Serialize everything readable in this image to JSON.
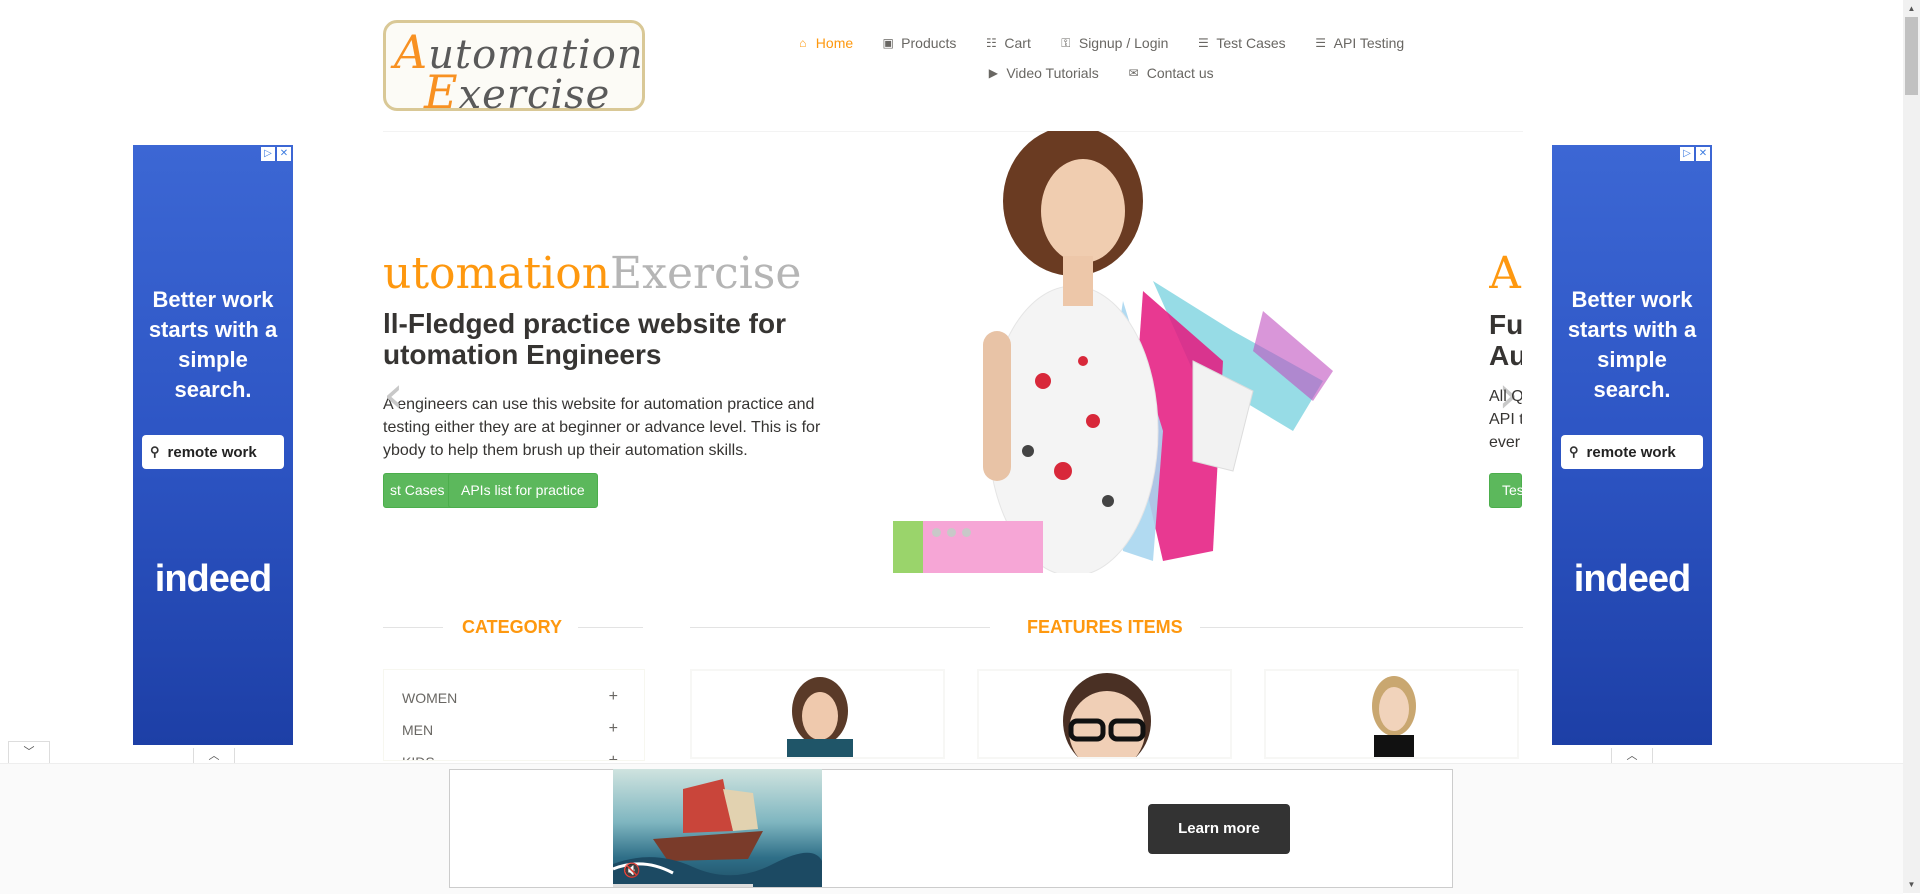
{
  "header": {
    "logo": {
      "line1_cap": "A",
      "line1_rest": "utomation",
      "line2_cap": "E",
      "line2_rest": "xercise"
    },
    "nav_row1": [
      {
        "label": "Home",
        "icon": "home-icon",
        "glyph": "⌂",
        "active": true
      },
      {
        "label": "Products",
        "icon": "products-icon",
        "glyph": "▣"
      },
      {
        "label": "Cart",
        "icon": "cart-icon",
        "glyph": "☷"
      },
      {
        "label": "Signup / Login",
        "icon": "lock-icon",
        "glyph": "⚿"
      },
      {
        "label": "Test Cases",
        "icon": "list-icon",
        "glyph": "☰"
      },
      {
        "label": "API Testing",
        "icon": "list-icon",
        "glyph": "☰"
      }
    ],
    "nav_row2": [
      {
        "label": "Video Tutorials",
        "icon": "youtube-icon",
        "glyph": "▶"
      },
      {
        "label": "Contact us",
        "icon": "envelope-icon",
        "glyph": "✉"
      }
    ]
  },
  "slider": {
    "title_a": "utomation",
    "title_b": "Exercise",
    "heading": "ll-Fledged practice website for utomation Engineers",
    "heading_line1": "ll-Fledged practice website for",
    "heading_line2": "utomation Engineers",
    "para_line1": "A engineers can use this website for automation practice and",
    "para_line2": "testing either they are at beginner or advance level. This is for",
    "para_line3": "ybody to help them brush up their automation skills.",
    "btn_test_cases": "st Cases",
    "btn_apis": "APIs list for practice",
    "next_title": "A",
    "next_h_line1": "Fu",
    "next_h_line2": "Au",
    "next_p_line1": "All Q",
    "next_p_line2": "API t",
    "next_p_line3": "ever",
    "next_btn": "Tes",
    "prev_arrow": "‹",
    "next_arrow": "›"
  },
  "sections": {
    "category_title": "CATEGORY",
    "features_title": "FEATURES ITEMS",
    "categories": [
      {
        "label": "WOMEN",
        "plus": "+"
      },
      {
        "label": "MEN",
        "plus": "+"
      },
      {
        "label": "KIDS",
        "plus": "+"
      }
    ]
  },
  "ads": {
    "side_headline": "Better work starts with a simple search.",
    "side_search_text": "remote work",
    "side_brand": "indeed",
    "bottom_button": "Learn more",
    "colors": {
      "ad_blue": "#2d55c4",
      "accent": "#fe980f",
      "green": "#5cb85c"
    }
  }
}
